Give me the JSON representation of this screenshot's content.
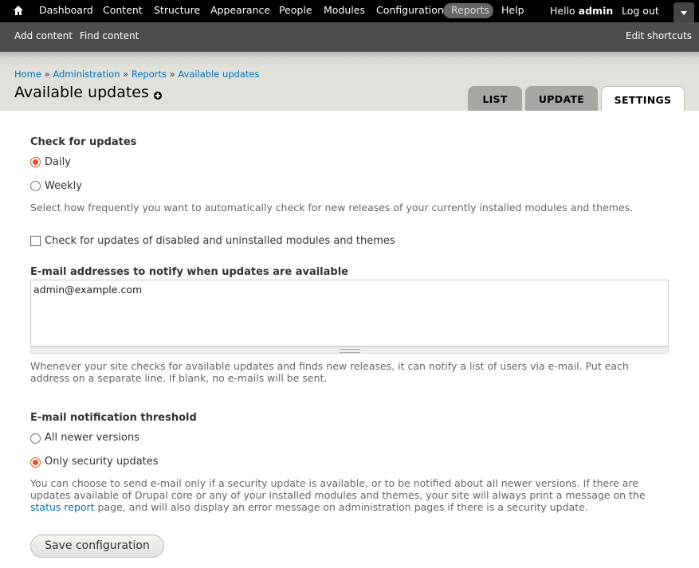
{
  "toolbar": {
    "menu": [
      "Dashboard",
      "Content",
      "Structure",
      "Appearance",
      "People",
      "Modules",
      "Configuration",
      "Reports",
      "Help"
    ],
    "active_item": "Reports",
    "hello_prefix": "Hello",
    "user": "admin",
    "logout": "Log out"
  },
  "shortcuts": {
    "add_content": "Add content",
    "find_content": "Find content",
    "edit_shortcuts": "Edit shortcuts"
  },
  "breadcrumb": [
    "Home",
    "Administration",
    "Reports",
    "Available updates"
  ],
  "breadcrumb_sep": "»",
  "page_title": "Available updates",
  "tabs": [
    {
      "label": "LIST",
      "active": false
    },
    {
      "label": "UPDATE",
      "active": false
    },
    {
      "label": "SETTINGS",
      "active": true
    }
  ],
  "check_for_updates": {
    "label": "Check for updates",
    "options": [
      {
        "label": "Daily",
        "checked": true
      },
      {
        "label": "Weekly",
        "checked": false
      }
    ],
    "description": "Select how frequently you want to automatically check for new releases of your currently installed modules and themes."
  },
  "check_disabled": {
    "label": "Check for updates of disabled and uninstalled modules and themes",
    "checked": false
  },
  "email": {
    "label": "E-mail addresses to notify when updates are available",
    "value": "admin@example.com",
    "description": "Whenever your site checks for available updates and finds new releases, it can notify a list of users via e-mail. Put each address on a separate line. If blank, no e-mails will be sent."
  },
  "threshold": {
    "label": "E-mail notification threshold",
    "options": [
      {
        "label": "All newer versions",
        "checked": false
      },
      {
        "label": "Only security updates",
        "checked": true
      }
    ],
    "description_before": "You can choose to send e-mail only if a security update is available, or to be notified about all newer versions. If there are updates available of Drupal core or any of your installed modules and themes, your site will always print a message on the",
    "status_link": "status report",
    "description_after": "page, and will also display an error message on administration pages if there is a security update."
  },
  "save_button": "Save configuration",
  "colors": {
    "accent_radio": "#e2541a",
    "link": "#0074bd",
    "toolbar_bg": "#000000",
    "shortcuts_bg": "#4d4d4d"
  }
}
